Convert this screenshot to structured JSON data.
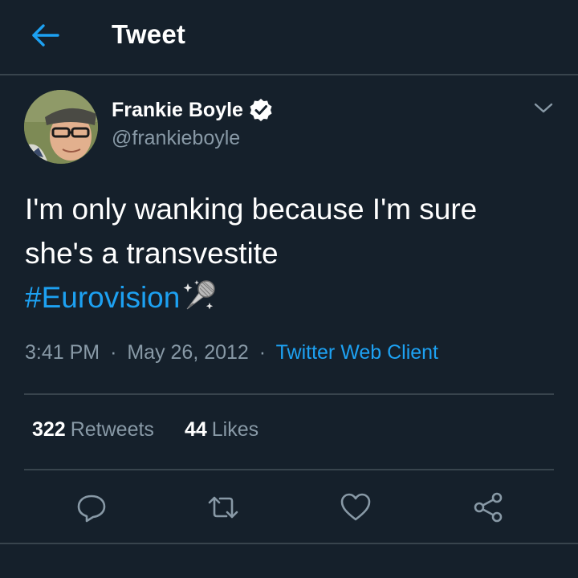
{
  "header": {
    "title": "Tweet",
    "back_icon": "arrow-left-icon"
  },
  "author": {
    "name": "Frankie Boyle",
    "handle": "@frankieboyle",
    "verified": true
  },
  "tweet": {
    "line1": "I'm only wanking because I'm sure",
    "line2": "she's a transvestite",
    "hashtag": "#Eurovision",
    "emoji": "microphone-sparkle-emoji"
  },
  "meta": {
    "time": "3:41 PM",
    "date": "May 26, 2012",
    "client": "Twitter Web Client",
    "separator": "·"
  },
  "stats": {
    "retweets_count": "322",
    "retweets_label": "Retweets",
    "likes_count": "44",
    "likes_label": "Likes"
  },
  "actions": [
    "reply-icon",
    "retweet-icon",
    "like-icon",
    "share-icon"
  ],
  "colors": {
    "background": "#15202b",
    "accent": "#1da1f2",
    "secondary_text": "#8899a6",
    "divider": "#38444d"
  }
}
